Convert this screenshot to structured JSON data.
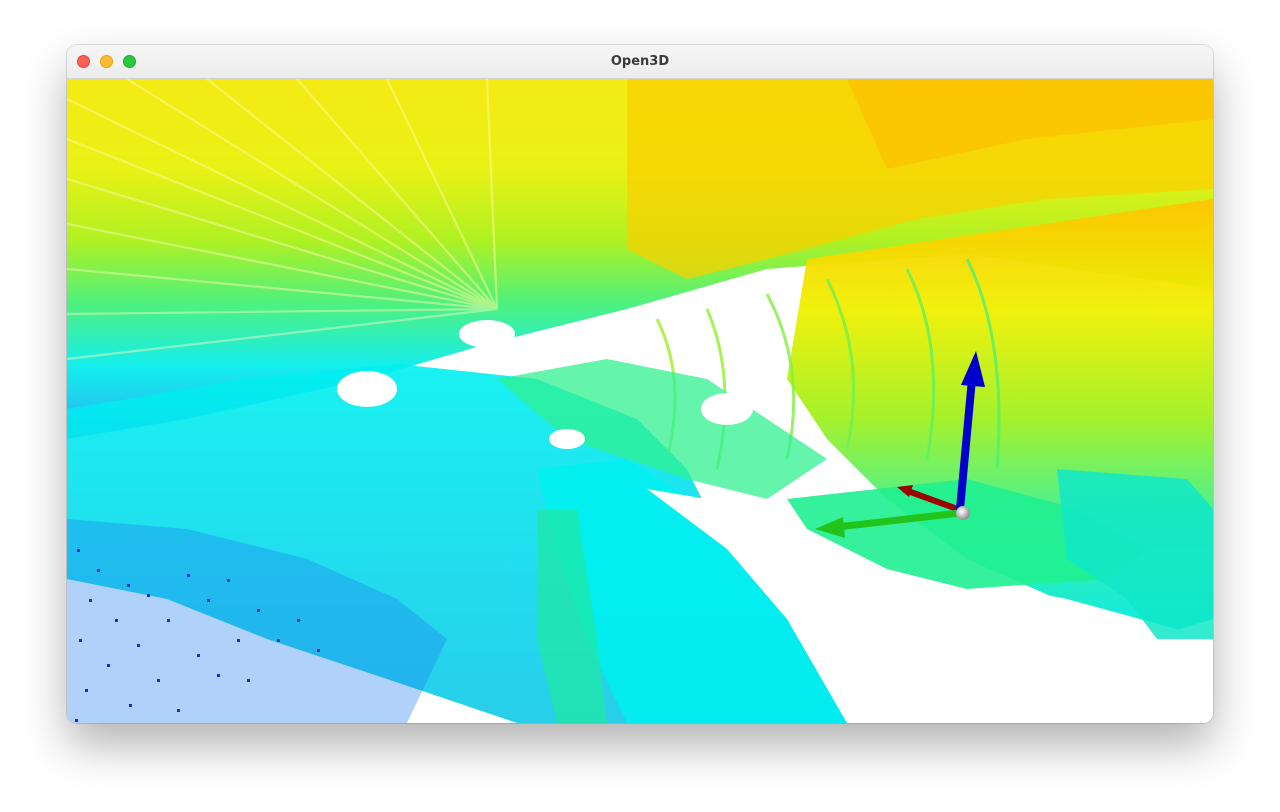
{
  "window": {
    "title": "Open3D"
  },
  "titlebar_buttons": {
    "close_color": "#fe5f57",
    "minimize_color": "#febc2e",
    "zoom_color": "#28c840"
  },
  "scene": {
    "background": "#ffffff",
    "colormap": [
      "#0a1fd4",
      "#1f7ff0",
      "#00f0f0",
      "#20f0a0",
      "#60f040",
      "#c8f000",
      "#f8f000",
      "#ffb000"
    ],
    "axes": {
      "x_color": "#b00000",
      "y_color": "#22c41c",
      "z_color": "#0000cc",
      "origin_color": "#b0b0b0"
    }
  }
}
